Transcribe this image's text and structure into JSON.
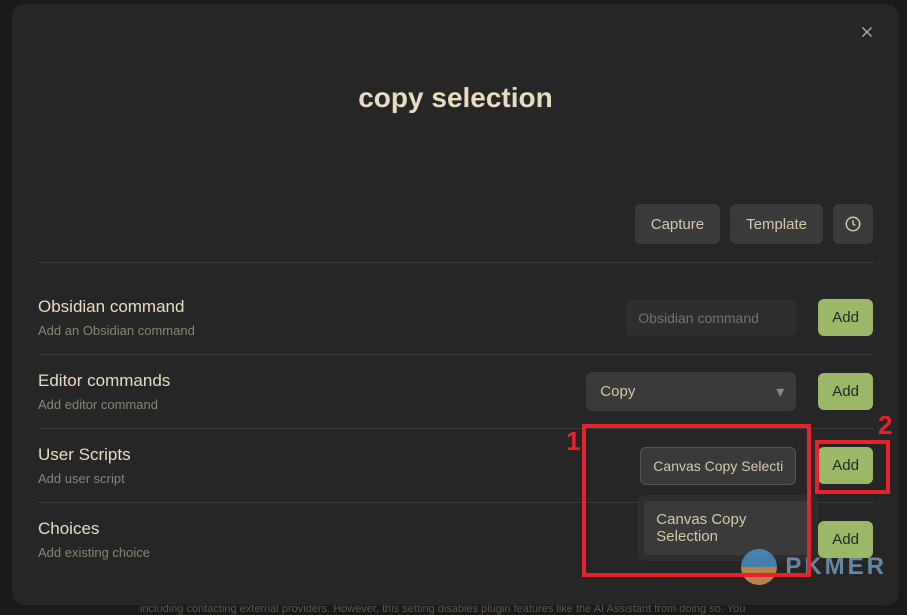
{
  "title": "copy selection",
  "topActions": {
    "capture": "Capture",
    "template": "Template"
  },
  "rows": {
    "obsidianCommand": {
      "title": "Obsidian command",
      "desc": "Add an Obsidian command",
      "placeholder": "Obsidian command",
      "addLabel": "Add"
    },
    "editorCommands": {
      "title": "Editor commands",
      "desc": "Add editor command",
      "selected": "Copy",
      "addLabel": "Add"
    },
    "userScripts": {
      "title": "User Scripts",
      "desc": "Add user script",
      "inputValue": "Canvas Copy Selectio",
      "dropdownItem": "Canvas Copy Selection",
      "addLabel": "Add"
    },
    "choices": {
      "title": "Choices",
      "desc": "Add existing choice",
      "addLabel": "Add"
    }
  },
  "annotations": {
    "one": "1",
    "two": "2"
  },
  "watermark": "PKMER",
  "bgText": "including contacting external providers. However, this setting disables plugin features like the AI Assistant from doing so. You"
}
